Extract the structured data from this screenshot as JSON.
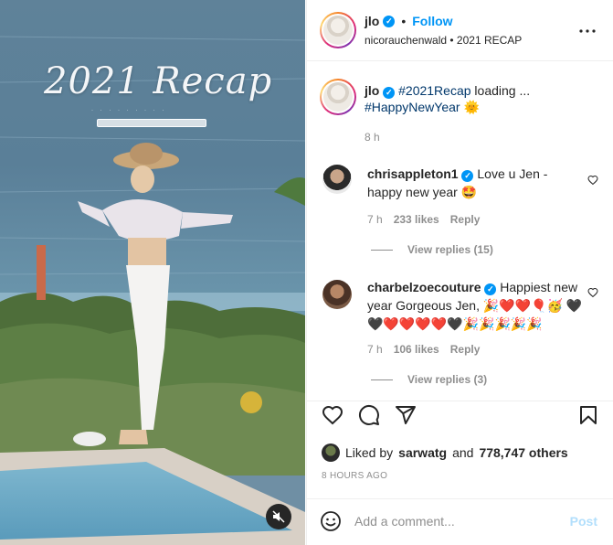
{
  "media": {
    "overlay_title": "2021 Recap",
    "overlay_subtitle": "· · · · · · · · ·",
    "mute_icon": "speaker-muted-icon"
  },
  "header": {
    "username": "jlo",
    "follow_label": "Follow",
    "dot": "•",
    "subtitle": "nicorauchenwald • 2021 RECAP",
    "more_icon": "more-horizontal-icon"
  },
  "caption": {
    "username": "jlo",
    "hashtag1": "#2021Recap",
    "text": " loading ...",
    "hashtag2": "#HappyNewYear",
    "emoji": "🌞",
    "time": "8 h"
  },
  "comments": [
    {
      "username": "chrisappleton1",
      "text": " Love u Jen - happy new year 🤩",
      "time": "7 h",
      "likes": "233 likes",
      "reply_label": "Reply",
      "view_replies": "View replies (15)"
    },
    {
      "username": "charbelzoecouture",
      "text": " Happiest new year Gorgeous Jen, 🎉❤️❤️🎈🥳 🖤🖤❤️❤️❤️❤️🖤🎉🎉🎉🎉🎉",
      "time": "7 h",
      "likes": "106 likes",
      "reply_label": "Reply",
      "view_replies": "View replies (3)"
    }
  ],
  "actions": {
    "like_icon": "heart-icon",
    "comment_icon": "comment-icon",
    "share_icon": "send-icon",
    "save_icon": "bookmark-icon",
    "liked_prefix": "Liked by",
    "liked_user": "sarwatg",
    "liked_and": "and",
    "liked_count": "778,747 others",
    "posted": "8 HOURS AGO"
  },
  "add_comment": {
    "placeholder": "Add a comment...",
    "post_label": "Post"
  },
  "colors": {
    "accent": "#0095f6",
    "link": "#00376b",
    "muted": "#8e8e8e",
    "post_disabled": "#b2dffc"
  }
}
